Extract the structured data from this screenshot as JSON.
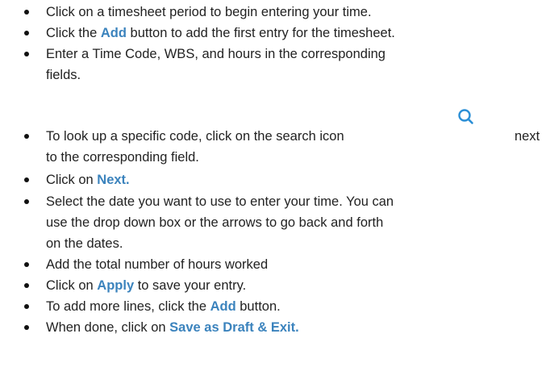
{
  "instructions": {
    "items": [
      {
        "segments": [
          {
            "text": "Click on a timesheet period to begin entering your time."
          }
        ]
      },
      {
        "segments": [
          {
            "text": "Click the "
          },
          {
            "text": "Add",
            "emphasis": true
          },
          {
            "text": " button to add the first entry for the timesheet."
          }
        ]
      },
      {
        "segments": [
          {
            "text": "Enter a Time Code, WBS, and hours in the corresponding"
          }
        ],
        "continuation": [
          "fields."
        ]
      },
      {
        "segments": [
          {
            "text": "To look up a specific code, click on the search icon"
          },
          {
            "text": "next"
          }
        ],
        "continuation": [
          "to the corresponding field."
        ],
        "icon": "search-icon"
      },
      {
        "segments": [
          {
            "text": "Click on "
          },
          {
            "text": "Next.",
            "emphasis": true
          }
        ]
      },
      {
        "segments": [
          {
            "text": "Select the date you want to use to enter your time. You can"
          }
        ],
        "continuation": [
          "use the drop down box or the arrows to go back and forth",
          "on the dates."
        ]
      },
      {
        "segments": [
          {
            "text": "Add the total number of hours worked"
          }
        ]
      },
      {
        "segments": [
          {
            "text": "Click on "
          },
          {
            "text": "Apply",
            "emphasis": true
          },
          {
            "text": " to save your entry."
          }
        ]
      },
      {
        "segments": [
          {
            "text": "To add more lines, click the "
          },
          {
            "text": "Add",
            "emphasis": true
          },
          {
            "text": " button."
          }
        ]
      },
      {
        "segments": [
          {
            "text": "When done, click on "
          },
          {
            "text": "Save as Draft & Exit.",
            "emphasis": true
          }
        ]
      }
    ]
  },
  "colors": {
    "accent": "#3b83bd",
    "text": "#222222"
  }
}
